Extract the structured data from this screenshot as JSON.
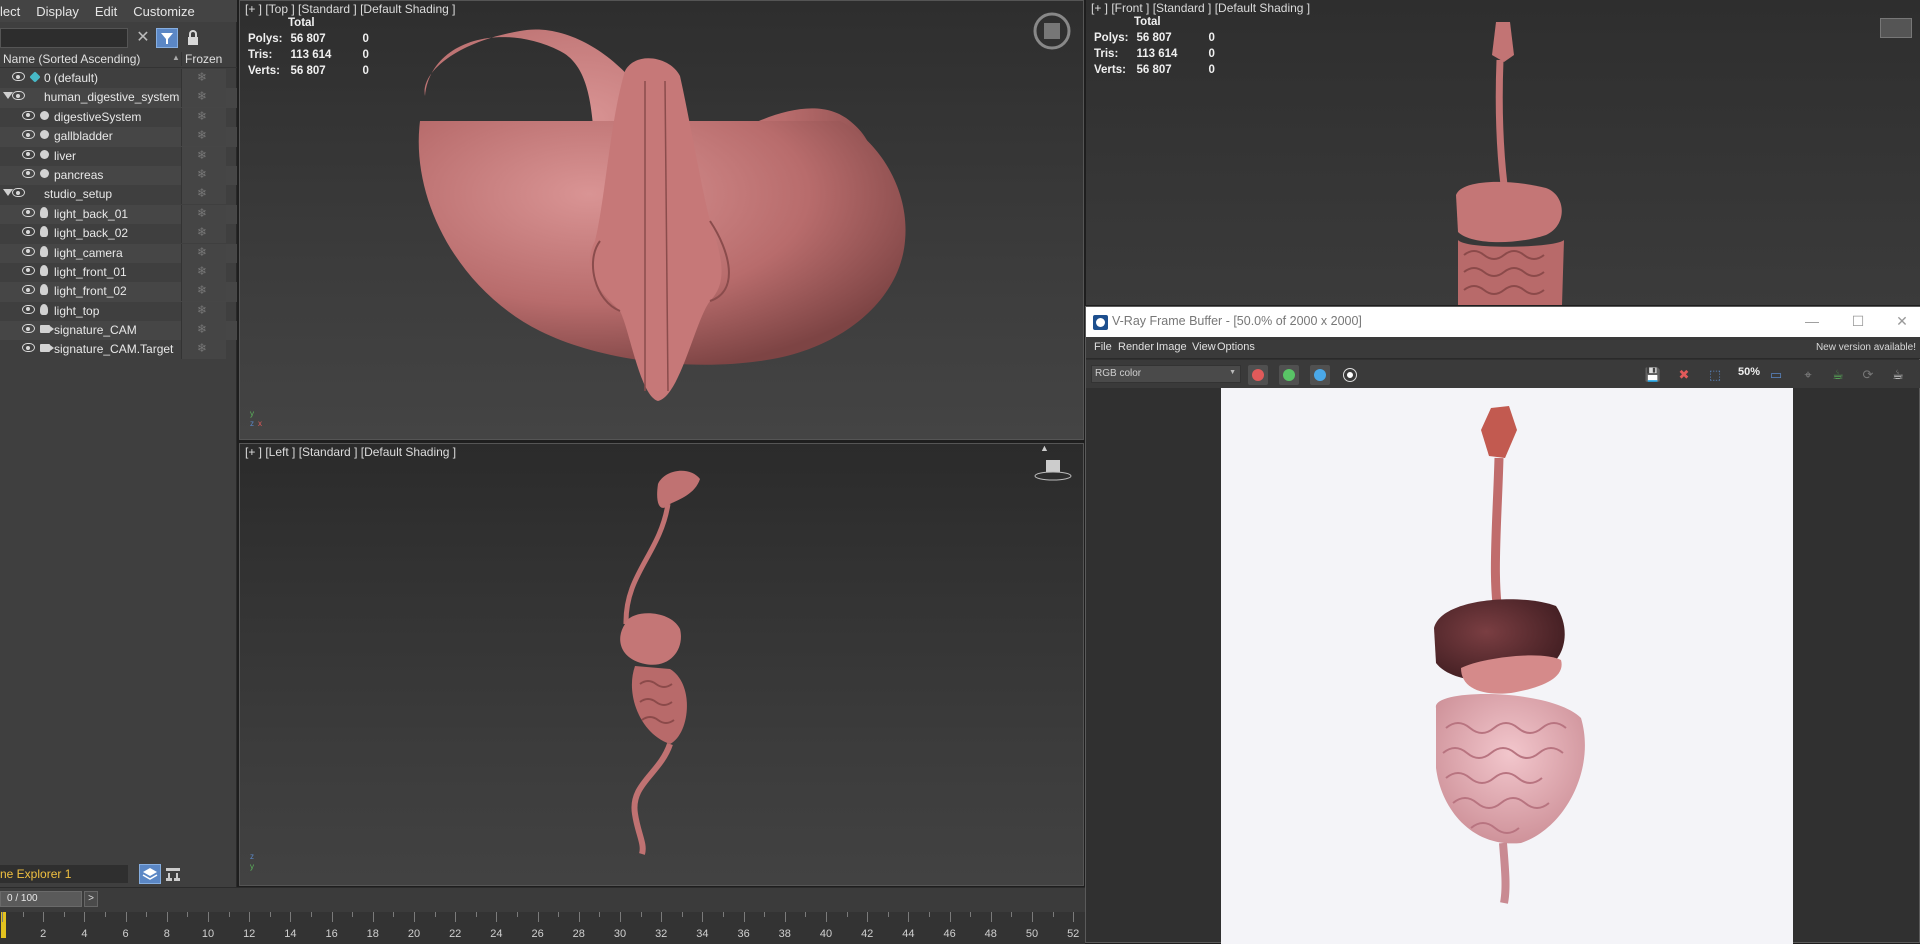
{
  "scene_explorer": {
    "menu": [
      "lect",
      "Display",
      "Edit",
      "Customize"
    ],
    "column_name": "Name (Sorted Ascending)",
    "column_frozen": "Frozen",
    "rows": [
      {
        "label": "0 (default)",
        "type": "layer"
      },
      {
        "label": "human_digestive_system",
        "type": "group"
      },
      {
        "label": "digestiveSystem",
        "type": "mesh"
      },
      {
        "label": "gallbladder",
        "type": "mesh"
      },
      {
        "label": "liver",
        "type": "mesh"
      },
      {
        "label": "pancreas",
        "type": "mesh"
      },
      {
        "label": "studio_setup",
        "type": "group"
      },
      {
        "label": "light_back_01",
        "type": "light"
      },
      {
        "label": "light_back_02",
        "type": "light"
      },
      {
        "label": "light_camera",
        "type": "light"
      },
      {
        "label": "light_front_01",
        "type": "light"
      },
      {
        "label": "light_front_02",
        "type": "light"
      },
      {
        "label": "light_top",
        "type": "light"
      },
      {
        "label": "signature_CAM",
        "type": "camera"
      },
      {
        "label": "signature_CAM.Target",
        "type": "camera"
      }
    ],
    "frozen_glyph": "❄",
    "tab_name": "ne Explorer 1"
  },
  "viewports": {
    "top": {
      "label": "[+ ] [Top ]  [Standard ]  [Default Shading ]"
    },
    "front": {
      "label": "[+ ] [Front ]  [Standard ]  [Default Shading ]"
    },
    "left": {
      "label": "[+ ] [Left ]  [Standard ]  [Default Shading ]"
    },
    "stats": {
      "header": "Total",
      "polys_label": "Polys:",
      "polys_value": "56 807",
      "polys_sel": "0",
      "tris_label": "Tris:",
      "tris_value": "113 614",
      "tris_sel": "0",
      "verts_label": "Verts:",
      "verts_value": "56 807",
      "verts_sel": "0"
    }
  },
  "vfb": {
    "title": "V-Ray Frame Buffer - [50.0% of 2000 x 2000]",
    "menu": [
      "File",
      "Render",
      "Image",
      "View",
      "Options"
    ],
    "new_version": "New version available!",
    "channel": "RGB color",
    "zoom": "50%",
    "colors": {
      "red": "#e05a5a",
      "green": "#59c466",
      "blue": "#4aa8e8"
    }
  },
  "timeline": {
    "frame": "0 / 100",
    "next_label": ">",
    "ticks": [
      2,
      4,
      6,
      8,
      10,
      12,
      14,
      16,
      18,
      20,
      22,
      24,
      26,
      28,
      30,
      32,
      34,
      36,
      38,
      40,
      42,
      44,
      46,
      48,
      50,
      52
    ]
  },
  "colors": {
    "accent": "#5b87c5",
    "organ": "#c77a7a",
    "highlight": "#e3c21f"
  }
}
